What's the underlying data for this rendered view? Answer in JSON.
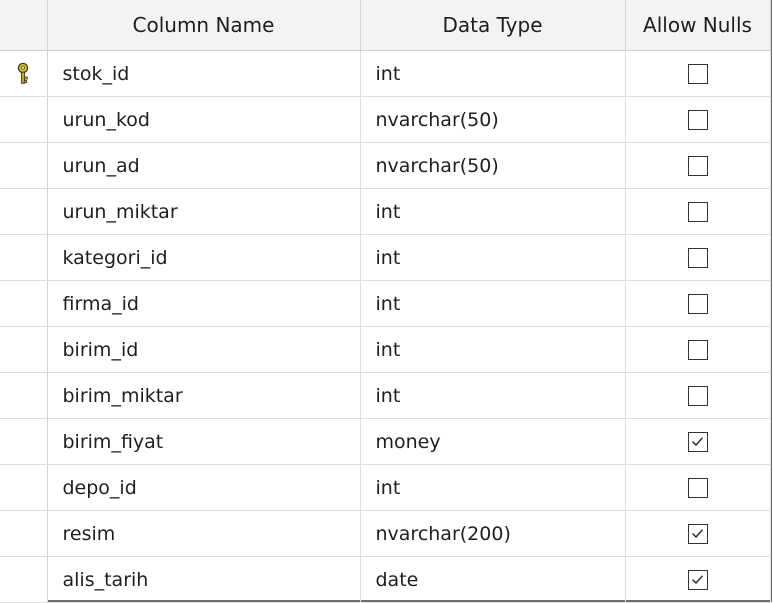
{
  "table": {
    "headers": {
      "column_name": "Column Name",
      "data_type": "Data Type",
      "allow_nulls": "Allow Nulls"
    },
    "rows": [
      {
        "name": "stok_id",
        "type": "int",
        "allow_nulls": false,
        "primary_key": true
      },
      {
        "name": "urun_kod",
        "type": "nvarchar(50)",
        "allow_nulls": false,
        "primary_key": false
      },
      {
        "name": "urun_ad",
        "type": "nvarchar(50)",
        "allow_nulls": false,
        "primary_key": false
      },
      {
        "name": "urun_miktar",
        "type": "int",
        "allow_nulls": false,
        "primary_key": false
      },
      {
        "name": "kategori_id",
        "type": "int",
        "allow_nulls": false,
        "primary_key": false
      },
      {
        "name": "firma_id",
        "type": "int",
        "allow_nulls": false,
        "primary_key": false
      },
      {
        "name": "birim_id",
        "type": "int",
        "allow_nulls": false,
        "primary_key": false
      },
      {
        "name": "birim_miktar",
        "type": "int",
        "allow_nulls": false,
        "primary_key": false
      },
      {
        "name": "birim_fiyat",
        "type": "money",
        "allow_nulls": true,
        "primary_key": false
      },
      {
        "name": "depo_id",
        "type": "int",
        "allow_nulls": false,
        "primary_key": false
      },
      {
        "name": "resim",
        "type": "nvarchar(200)",
        "allow_nulls": true,
        "primary_key": false
      },
      {
        "name": "alis_tarih",
        "type": "date",
        "allow_nulls": true,
        "primary_key": false
      }
    ]
  },
  "icons": {
    "primary_key": "key-icon",
    "checked": "checkmark-icon"
  },
  "colors": {
    "key_gold": "#e8c400",
    "header_bg": "#f3f3f3",
    "grid_line": "#dedede",
    "frame_border": "#6e6e6e"
  }
}
